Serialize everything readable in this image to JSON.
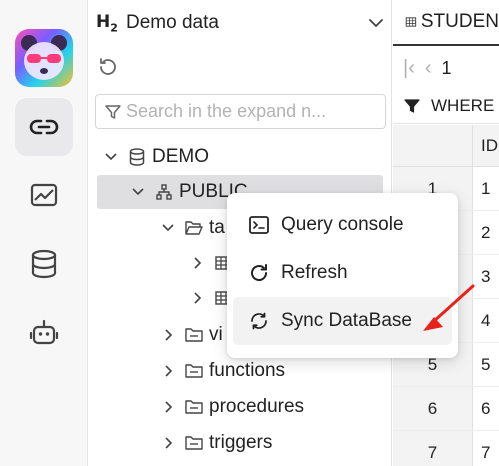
{
  "rail": {
    "items": [
      {
        "name": "connections",
        "icon": "link-icon",
        "active": true
      },
      {
        "name": "dashboard",
        "icon": "chart-icon",
        "active": false
      },
      {
        "name": "database",
        "icon": "database-icon",
        "active": false
      },
      {
        "name": "ai",
        "icon": "robot-icon",
        "active": false
      }
    ]
  },
  "panel": {
    "logo_text": "H",
    "logo_sub": "2",
    "title": "Demo data",
    "search_placeholder": "Search in the expand n..."
  },
  "tree": {
    "demo": "DEMO",
    "public": "PUBLIC",
    "tables": "ta",
    "views": "vi",
    "functions": "functions",
    "procedures": "procedures",
    "triggers": "triggers"
  },
  "tab": {
    "label": "STUDEN"
  },
  "pager": {
    "page": "1"
  },
  "where": {
    "label": "WHERE"
  },
  "grid": {
    "header": "ID",
    "rows": [
      {
        "rn": "1",
        "id": "1"
      },
      {
        "rn": "2",
        "id": "2"
      },
      {
        "rn": "3",
        "id": "3"
      },
      {
        "rn": "4",
        "id": "4"
      },
      {
        "rn": "5",
        "id": "5"
      },
      {
        "rn": "6",
        "id": "6"
      },
      {
        "rn": "7",
        "id": "7"
      }
    ]
  },
  "context_menu": {
    "items": [
      {
        "label": "Query console",
        "icon": "terminal-icon"
      },
      {
        "label": "Refresh",
        "icon": "refresh-icon"
      },
      {
        "label": "Sync DataBase",
        "icon": "sync-icon"
      }
    ]
  },
  "colors": {
    "accent_arrow": "#e8221b",
    "selected_row": "#dfdfe2",
    "rail_bg": "#f7f7f8"
  }
}
